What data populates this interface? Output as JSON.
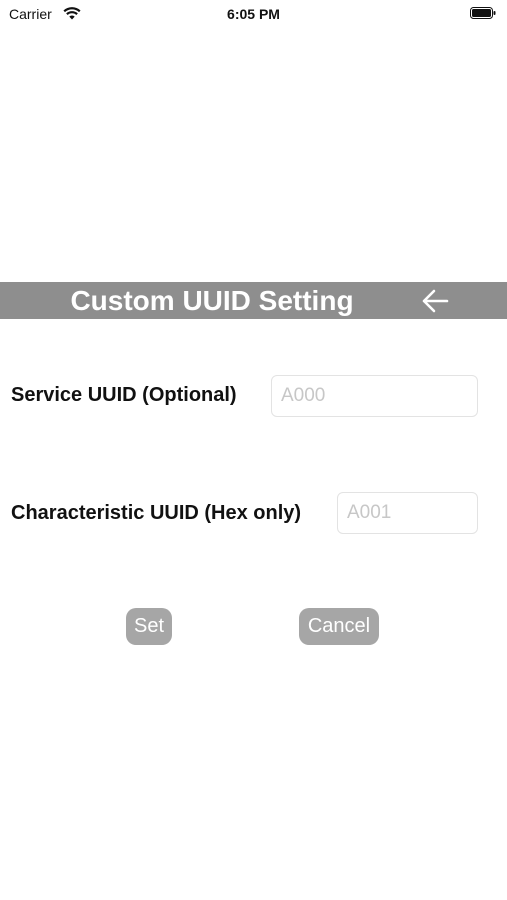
{
  "status_bar": {
    "carrier": "Carrier",
    "time": "6:05 PM",
    "icons": [
      "wifi-icon",
      "battery-icon"
    ]
  },
  "header": {
    "title": "Custom UUID Setting",
    "back_icon": "arrow-left-icon",
    "background_color": "#8e8e8e",
    "title_color": "#ffffff"
  },
  "form": {
    "service": {
      "label": "Service UUID (Optional)",
      "value": "",
      "placeholder": "A000"
    },
    "characteristic": {
      "label": "Characteristic UUID (Hex only)",
      "value": "",
      "placeholder": "A001"
    }
  },
  "actions": {
    "set_label": "Set",
    "cancel_label": "Cancel",
    "button_color": "#a6a6a6"
  }
}
